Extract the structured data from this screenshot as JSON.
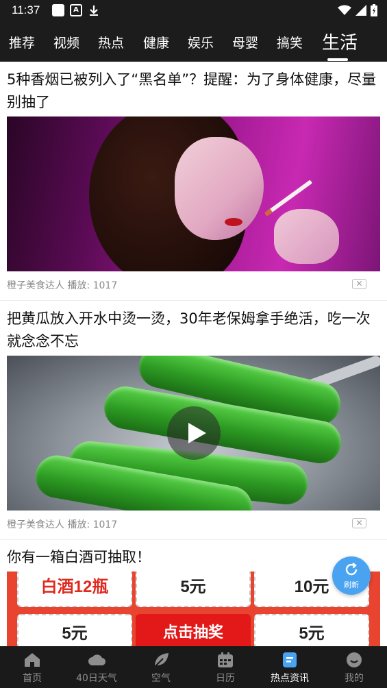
{
  "status_bar": {
    "time": "11:37",
    "notification_letter": "A"
  },
  "tabs": {
    "items": [
      "推荐",
      "视频",
      "热点",
      "健康",
      "娱乐",
      "母婴",
      "搞笑",
      "生活"
    ],
    "active_index": 7
  },
  "articles": [
    {
      "title": "5种香烟已被列入了“黑名单”？提醒：为了身体健康，尽量别抽了",
      "author": "橙子美食达人",
      "plays": "播放: 1017",
      "close_label": "✕"
    },
    {
      "title": "把黄瓜放入开水中烫一烫，30年老保姆拿手绝活，吃一次就念念不忘",
      "author": "橙子美食达人",
      "plays": "播放: 1017",
      "close_label": "✕"
    }
  ],
  "promo": {
    "title": "你有一箱白酒可抽取！",
    "prizes": [
      "白酒12瓶",
      "5元",
      "10元",
      "5元",
      "点击抽奖",
      "5元"
    ]
  },
  "refresh": {
    "label": "刷新"
  },
  "bottom_nav": {
    "items": [
      {
        "label": "首页",
        "icon": "home-icon"
      },
      {
        "label": "40日天气",
        "icon": "cloud-icon"
      },
      {
        "label": "空气",
        "icon": "leaf-icon"
      },
      {
        "label": "日历",
        "icon": "calendar-icon"
      },
      {
        "label": "热点资讯",
        "icon": "news-icon"
      },
      {
        "label": "我的",
        "icon": "profile-icon"
      }
    ],
    "active_index": 4
  },
  "colors": {
    "bar_bg": "#1c1c1c",
    "accent_blue": "#4aa3f0",
    "promo_red": "#e31818"
  }
}
